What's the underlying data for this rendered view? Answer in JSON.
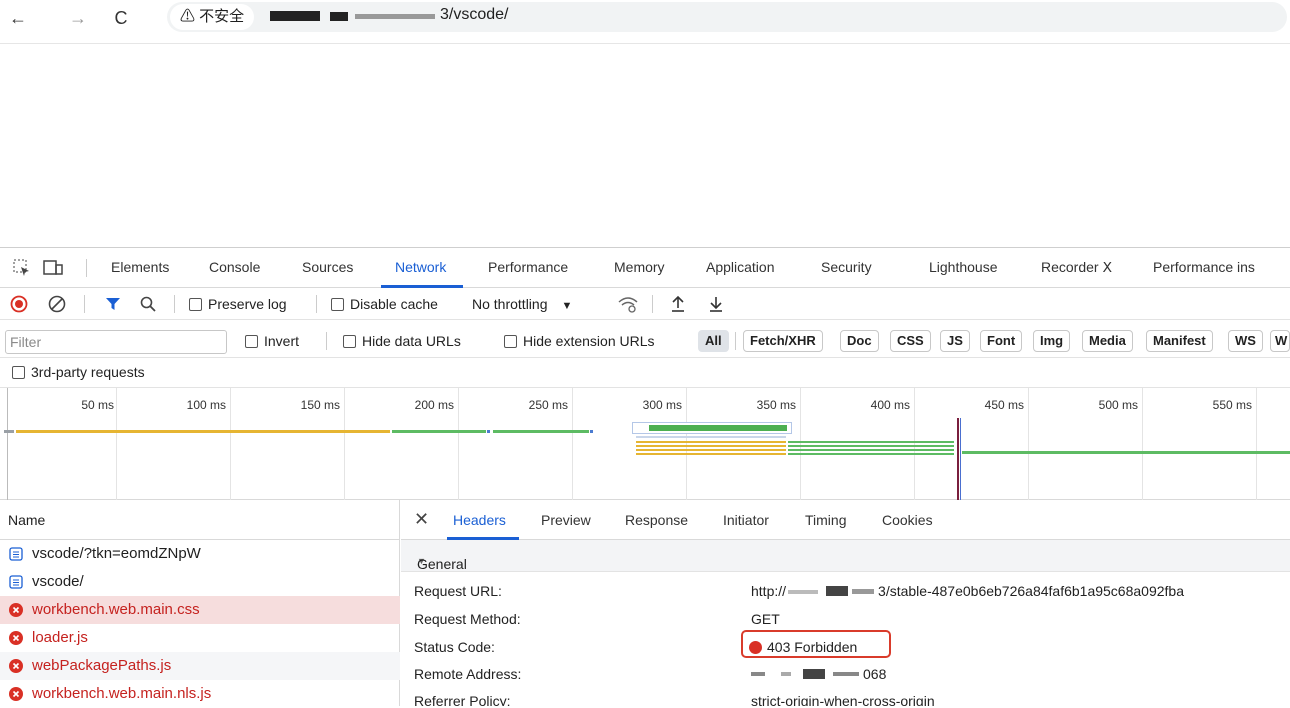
{
  "browser": {
    "security_label": "⚠ 不安全",
    "url_suffix": "3/vscode/"
  },
  "devtools": {
    "tabs": [
      "Elements",
      "Console",
      "Sources",
      "Network",
      "Performance",
      "Memory",
      "Application",
      "Security",
      "Lighthouse",
      "Recorder Ⅹ",
      "Performance ins"
    ],
    "active_tab": "Network",
    "toolbar": {
      "preserve_log": "Preserve log",
      "disable_cache": "Disable cache",
      "throttling": "No throttling"
    },
    "filter": {
      "placeholder": "Filter",
      "invert": "Invert",
      "hide_data_urls": "Hide data URLs",
      "hide_extension_urls": "Hide extension URLs",
      "types": [
        "All",
        "Fetch/XHR",
        "Doc",
        "CSS",
        "JS",
        "Font",
        "Img",
        "Media",
        "Manifest",
        "WS",
        "W"
      ],
      "third_party": "3rd-party requests"
    },
    "timeline_ticks": [
      "50 ms",
      "100 ms",
      "150 ms",
      "200 ms",
      "250 ms",
      "300 ms",
      "350 ms",
      "400 ms",
      "450 ms",
      "500 ms",
      "550 ms"
    ],
    "name_header": "Name",
    "requests": [
      {
        "name": "vscode/?tkn=eomdZNpW",
        "status": "ok"
      },
      {
        "name": "vscode/",
        "status": "ok"
      },
      {
        "name": "workbench.web.main.css",
        "status": "error"
      },
      {
        "name": "loader.js",
        "status": "error"
      },
      {
        "name": "webPackagePaths.js",
        "status": "error"
      },
      {
        "name": "workbench.web.main.nls.js",
        "status": "error"
      }
    ],
    "detail_tabs": [
      "Headers",
      "Preview",
      "Response",
      "Initiator",
      "Timing",
      "Cookies"
    ],
    "active_detail_tab": "Headers",
    "general": {
      "title": "General",
      "request_url_label": "Request URL:",
      "request_url_prefix": "http://",
      "request_url_suffix": "3/stable-487e0b6eb726a84faf6b1a95c68a092fba",
      "request_method_label": "Request Method:",
      "request_method": "GET",
      "status_code_label": "Status Code:",
      "status_code": "403 Forbidden",
      "remote_address_label": "Remote Address:",
      "remote_address_suffix": "068",
      "referrer_policy_label": "Referrer Policy:",
      "referrer_policy": "strict-origin-when-cross-origin"
    }
  }
}
